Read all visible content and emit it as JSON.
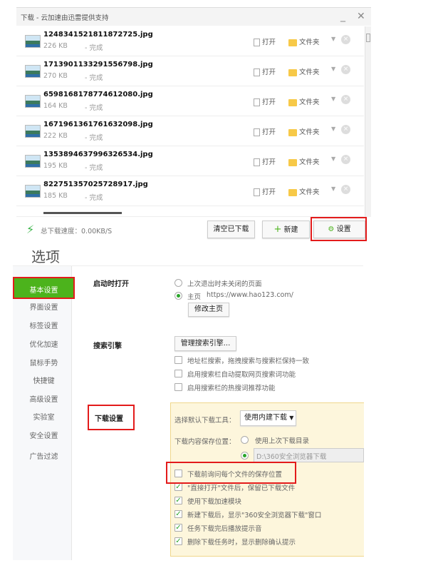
{
  "download_window": {
    "title": "下载 - 云加速由迅雷提供支持",
    "minimize": "_",
    "close": "✕",
    "files": [
      {
        "name": "1248341521811872725.jpg",
        "size": "226 KB",
        "status": "- 完成"
      },
      {
        "name": "1713901133291556798.jpg",
        "size": "270 KB",
        "status": "- 完成"
      },
      {
        "name": "6598168178774612080.jpg",
        "size": "164 KB",
        "status": "- 完成"
      },
      {
        "name": "1671961361761632098.jpg",
        "size": "222 KB",
        "status": "- 完成"
      },
      {
        "name": "1353894637996326534.jpg",
        "size": "195 KB",
        "status": "- 完成"
      },
      {
        "name": "822751357025728917.jpg",
        "size": "185 KB",
        "status": "- 完成"
      }
    ],
    "open_label": "打开",
    "folder_label": "文件夹",
    "speed": "总下载速度：0.00KB/S",
    "clear_label": "清空已下载",
    "new_label": "新建",
    "settings_label": "设置"
  },
  "options": {
    "title": "选项",
    "sidebar": [
      "基本设置",
      "界面设置",
      "标签设置",
      "优化加速",
      "鼠标手势",
      "快捷键",
      "高级设置",
      "实验室",
      "安全设置",
      "广告过滤"
    ],
    "startup": {
      "label": "启动时打开",
      "opt1": "上次退出时未关闭的页面",
      "opt2": "主页",
      "url": "https://www.hao123.com/",
      "button": "修改主页"
    },
    "search": {
      "label": "搜索引擎",
      "button": "管理搜索引擎...",
      "checks": [
        "地址栏搜索，拖拽搜索与搜索栏保持一致",
        "启用搜索栏自动提取网页搜索词功能",
        "启用搜索栏的热搜词推荐功能"
      ]
    },
    "download": {
      "label": "下载设置",
      "tool_label": "选择默认下载工具：",
      "tool_value": "使用内建下载",
      "save_label": "下载内容保存位置：",
      "save_opt1": "使用上次下载目录",
      "save_path": "D:\\360安全浏览器下载",
      "checks": [
        {
          "text": "下载前询问每个文件的保存位置",
          "checked": false
        },
        {
          "text": "\"直接打开\"文件后，保留已下载文件",
          "checked": true
        },
        {
          "text": "使用下载加速模块",
          "checked": true
        },
        {
          "text": "新建下载后，显示\"360安全浏览器下载\"窗口",
          "checked": true
        },
        {
          "text": "任务下载完后播放提示音",
          "checked": true
        },
        {
          "text": "删除下载任务时，显示删除确认提示",
          "checked": true
        }
      ]
    }
  },
  "colors": {
    "accent": "#4cb31c",
    "highlight": "#e31b1b",
    "panel": "#fdf6dc"
  }
}
